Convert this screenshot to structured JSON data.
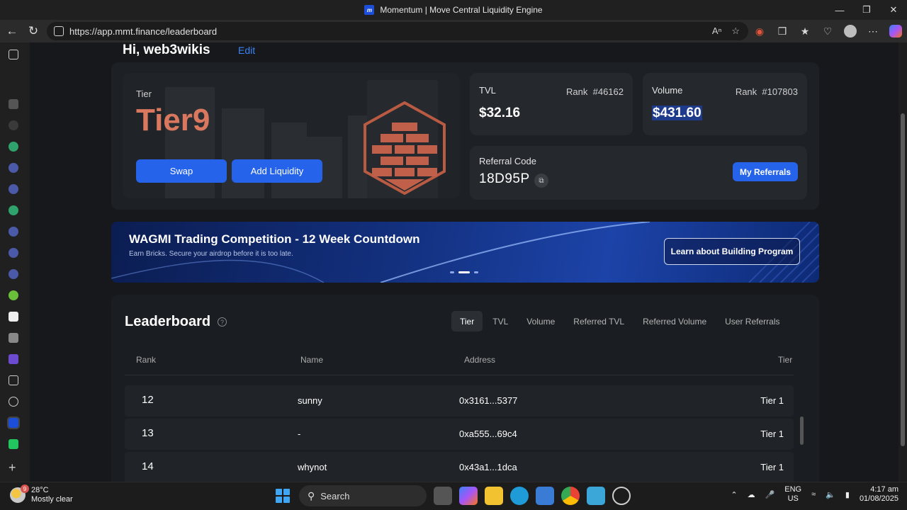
{
  "window": {
    "title": "Momentum | Move Central Liquidity Engine"
  },
  "browser": {
    "url": "https://app.mmt.finance/leaderboard"
  },
  "profile": {
    "greeting": "Hi, web3wikis",
    "edit_label": "Edit"
  },
  "tier_card": {
    "label": "Tier",
    "value": "Tier9",
    "swap_label": "Swap",
    "add_liquidity_label": "Add Liquidity"
  },
  "tvl_card": {
    "label": "TVL",
    "rank": "Rank  #46162",
    "value": "$32.16"
  },
  "volume_card": {
    "label": "Volume",
    "rank": "Rank  #107803",
    "value": "$431.60"
  },
  "referral_card": {
    "label": "Referral Code",
    "code": "18D95P",
    "button_label": "My Referrals"
  },
  "banner": {
    "title": "WAGMI Trading Competition - 12 Week Countdown",
    "subtitle": "Earn Bricks. Secure your airdrop before it is too late.",
    "button_label": "Learn about Building Program"
  },
  "leaderboard": {
    "title": "Leaderboard",
    "tabs": [
      "Tier",
      "TVL",
      "Volume",
      "Referred TVL",
      "Referred Volume",
      "User Referrals"
    ],
    "active_tab": "Tier",
    "columns": [
      "Rank",
      "Name",
      "Address",
      "Tier"
    ],
    "rows": [
      {
        "rank": "12",
        "name": "sunny",
        "address": "0x3161...5377",
        "tier": "Tier 1"
      },
      {
        "rank": "13",
        "name": "-",
        "address": "0xa555...69c4",
        "tier": "Tier 1"
      },
      {
        "rank": "14",
        "name": "whynot",
        "address": "0x43a1...1dca",
        "tier": "Tier 1"
      }
    ]
  },
  "taskbar": {
    "temperature": "28°C",
    "weather": "Mostly clear",
    "weather_badge": "9",
    "search_label": "Search",
    "lang": "ENG",
    "region": "US",
    "time": "4:17 am",
    "date": "01/08/2025"
  },
  "colors": {
    "accent": "#2563eb",
    "tier_text": "#d9785f",
    "link": "#3b82f6"
  }
}
